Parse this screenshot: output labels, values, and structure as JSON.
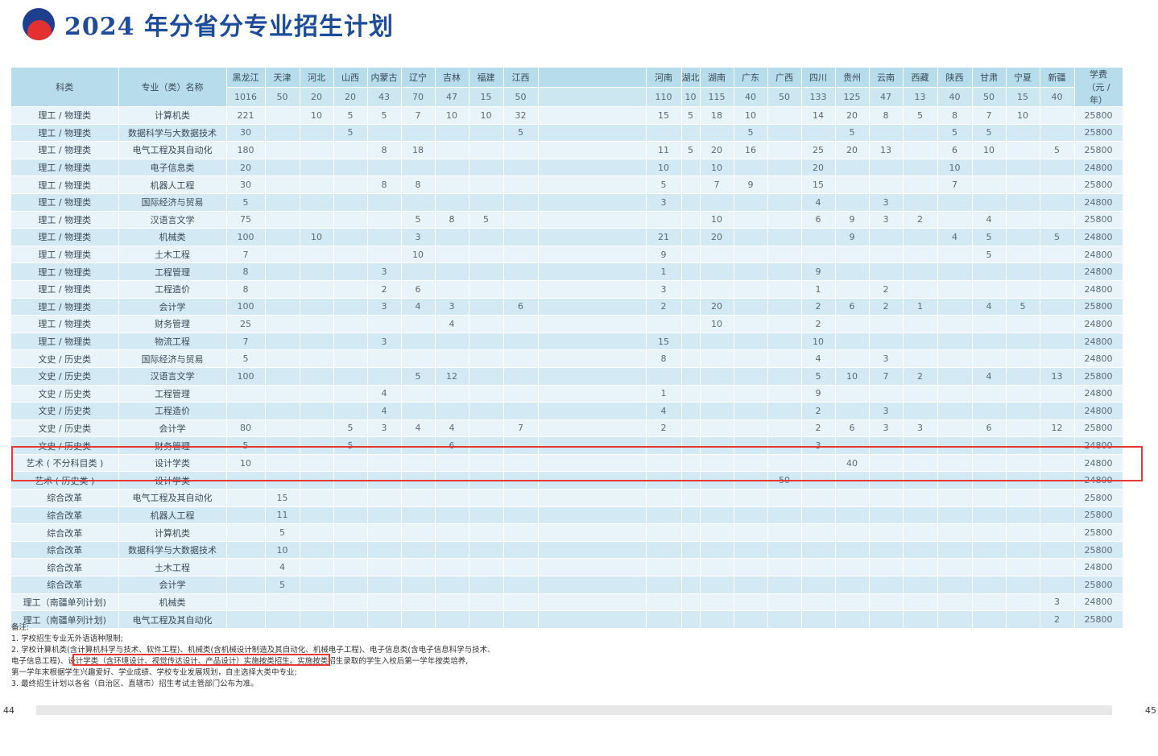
{
  "title": "2024 年分省分专业招生计划",
  "header": {
    "category": "科类",
    "major": "专业（类）名称",
    "tuition": "学费（元 / 年）",
    "provinces": [
      "黑龙江",
      "天津",
      "河北",
      "山西",
      "内蒙古",
      "辽宁",
      "吉林",
      "福建",
      "江西",
      "",
      "河南",
      "湖北",
      "湖南",
      "广东",
      "广西",
      "四川",
      "贵州",
      "云南",
      "西藏",
      "陕西",
      "甘肃",
      "宁夏",
      "新疆"
    ],
    "totals": [
      "1016",
      "50",
      "20",
      "20",
      "43",
      "70",
      "47",
      "15",
      "50",
      "",
      "110",
      "10",
      "115",
      "40",
      "50",
      "133",
      "125",
      "47",
      "13",
      "40",
      "50",
      "15",
      "40"
    ]
  },
  "rows": [
    {
      "category": "理工 / 物理类",
      "major": "计算机类",
      "values": [
        "221",
        "",
        "10",
        "5",
        "5",
        "7",
        "10",
        "10",
        "32",
        "",
        "15",
        "5",
        "18",
        "10",
        "",
        "14",
        "20",
        "8",
        "5",
        "8",
        "7",
        "10",
        ""
      ],
      "fee": "25800"
    },
    {
      "category": "理工 / 物理类",
      "major": "数据科学与大数据技术",
      "values": [
        "30",
        "",
        "",
        "5",
        "",
        "",
        "",
        "",
        "5",
        "",
        "",
        "",
        "",
        "5",
        "",
        "",
        "5",
        "",
        "",
        "5",
        "5",
        "",
        ""
      ],
      "fee": "25800"
    },
    {
      "category": "理工 / 物理类",
      "major": "电气工程及其自动化",
      "values": [
        "180",
        "",
        "",
        "",
        "8",
        "18",
        "",
        "",
        "",
        "",
        "11",
        "5",
        "20",
        "16",
        "",
        "25",
        "20",
        "13",
        "",
        "6",
        "10",
        "",
        "5"
      ],
      "fee": "25800"
    },
    {
      "category": "理工 / 物理类",
      "major": "电子信息类",
      "values": [
        "20",
        "",
        "",
        "",
        "",
        "",
        "",
        "",
        "",
        "",
        "10",
        "",
        "10",
        "",
        "",
        "20",
        "",
        "",
        "",
        "10",
        "",
        "",
        ""
      ],
      "fee": "24800"
    },
    {
      "category": "理工 / 物理类",
      "major": "机器人工程",
      "values": [
        "30",
        "",
        "",
        "",
        "8",
        "8",
        "",
        "",
        "",
        "",
        "5",
        "",
        "7",
        "9",
        "",
        "15",
        "",
        "",
        "",
        "7",
        "",
        "",
        ""
      ],
      "fee": "25800"
    },
    {
      "category": "理工 / 物理类",
      "major": "国际经济与贸易",
      "values": [
        "5",
        "",
        "",
        "",
        "",
        "",
        "",
        "",
        "",
        "",
        "3",
        "",
        "",
        "",
        "",
        "4",
        "",
        "3",
        "",
        "",
        "",
        "",
        ""
      ],
      "fee": "24800"
    },
    {
      "category": "理工 / 物理类",
      "major": "汉语言文学",
      "values": [
        "75",
        "",
        "",
        "",
        "",
        "5",
        "8",
        "5",
        "",
        "",
        "",
        "",
        "10",
        "",
        "",
        "6",
        "9",
        "3",
        "2",
        "",
        "4",
        "",
        ""
      ],
      "fee": "25800"
    },
    {
      "category": "理工 / 物理类",
      "major": "机械类",
      "values": [
        "100",
        "",
        "10",
        "",
        "",
        "3",
        "",
        "",
        "",
        "",
        "21",
        "",
        "20",
        "",
        "",
        "",
        "9",
        "",
        "",
        "4",
        "5",
        "",
        "5"
      ],
      "fee": "24800"
    },
    {
      "category": "理工 / 物理类",
      "major": "土木工程",
      "values": [
        "7",
        "",
        "",
        "",
        "",
        "10",
        "",
        "",
        "",
        "",
        "9",
        "",
        "",
        "",
        "",
        "",
        "",
        "",
        "",
        "",
        "5",
        "",
        ""
      ],
      "fee": "24800"
    },
    {
      "category": "理工 / 物理类",
      "major": "工程管理",
      "values": [
        "8",
        "",
        "",
        "",
        "3",
        "",
        "",
        "",
        "",
        "",
        "1",
        "",
        "",
        "",
        "",
        "9",
        "",
        "",
        "",
        "",
        "",
        "",
        ""
      ],
      "fee": "24800"
    },
    {
      "category": "理工 / 物理类",
      "major": "工程造价",
      "values": [
        "8",
        "",
        "",
        "",
        "2",
        "6",
        "",
        "",
        "",
        "",
        "3",
        "",
        "",
        "",
        "",
        "1",
        "",
        "2",
        "",
        "",
        "",
        "",
        ""
      ],
      "fee": "24800"
    },
    {
      "category": "理工 / 物理类",
      "major": "会计学",
      "values": [
        "100",
        "",
        "",
        "",
        "3",
        "4",
        "3",
        "",
        "6",
        "",
        "2",
        "",
        "20",
        "",
        "",
        "2",
        "6",
        "2",
        "1",
        "",
        "4",
        "5",
        ""
      ],
      "fee": "25800"
    },
    {
      "category": "理工 / 物理类",
      "major": "财务管理",
      "values": [
        "25",
        "",
        "",
        "",
        "",
        "",
        "4",
        "",
        "",
        "",
        "",
        "",
        "10",
        "",
        "",
        "2",
        "",
        "",
        "",
        "",
        "",
        "",
        ""
      ],
      "fee": "24800"
    },
    {
      "category": "理工 / 物理类",
      "major": "物流工程",
      "values": [
        "7",
        "",
        "",
        "",
        "3",
        "",
        "",
        "",
        "",
        "",
        "15",
        "",
        "",
        "",
        "",
        "10",
        "",
        "",
        "",
        "",
        "",
        "",
        ""
      ],
      "fee": "24800"
    },
    {
      "category": "文史 / 历史类",
      "major": "国际经济与贸易",
      "values": [
        "5",
        "",
        "",
        "",
        "",
        "",
        "",
        "",
        "",
        "",
        "8",
        "",
        "",
        "",
        "",
        "4",
        "",
        "3",
        "",
        "",
        "",
        "",
        ""
      ],
      "fee": "24800"
    },
    {
      "category": "文史 / 历史类",
      "major": "汉语言文学",
      "values": [
        "100",
        "",
        "",
        "",
        "",
        "5",
        "12",
        "",
        "",
        "",
        "",
        "",
        "",
        "",
        "",
        "5",
        "10",
        "7",
        "2",
        "",
        "4",
        "",
        "13"
      ],
      "fee": "25800"
    },
    {
      "category": "文史 / 历史类",
      "major": "工程管理",
      "values": [
        "",
        "",
        "",
        "",
        "4",
        "",
        "",
        "",
        "",
        "",
        "1",
        "",
        "",
        "",
        "",
        "9",
        "",
        "",
        "",
        "",
        "",
        "",
        ""
      ],
      "fee": "24800"
    },
    {
      "category": "文史 / 历史类",
      "major": "工程造价",
      "values": [
        "",
        "",
        "",
        "",
        "4",
        "",
        "",
        "",
        "",
        "",
        "4",
        "",
        "",
        "",
        "",
        "2",
        "",
        "3",
        "",
        "",
        "",
        "",
        ""
      ],
      "fee": "24800"
    },
    {
      "category": "文史 / 历史类",
      "major": "会计学",
      "values": [
        "80",
        "",
        "",
        "5",
        "3",
        "4",
        "4",
        "",
        "7",
        "",
        "2",
        "",
        "",
        "",
        "",
        "2",
        "6",
        "3",
        "3",
        "",
        "6",
        "",
        "12"
      ],
      "fee": "25800"
    },
    {
      "category": "文史 / 历史类",
      "major": "财务管理",
      "values": [
        "5",
        "",
        "",
        "5",
        "",
        "",
        "6",
        "",
        "",
        "",
        "",
        "",
        "",
        "",
        "",
        "3",
        "",
        "",
        "",
        "",
        "",
        "",
        ""
      ],
      "fee": "24800"
    },
    {
      "category": "艺术 ( 不分科目类 )",
      "major": "设计学类",
      "values": [
        "10",
        "",
        "",
        "",
        "",
        "",
        "",
        "",
        "",
        "",
        "",
        "",
        "",
        "",
        "",
        "",
        "40",
        "",
        "",
        "",
        "",
        "",
        ""
      ],
      "fee": "24800"
    },
    {
      "category": "艺术 ( 历史类 )",
      "major": "设计学类",
      "values": [
        "",
        "",
        "",
        "",
        "",
        "",
        "",
        "",
        "",
        "",
        "",
        "",
        "",
        "",
        "50",
        "",
        "",
        "",
        "",
        "",
        "",
        "",
        ""
      ],
      "fee": "24800"
    },
    {
      "category": "综合改革",
      "major": "电气工程及其自动化",
      "values": [
        "",
        "15",
        "",
        "",
        "",
        "",
        "",
        "",
        "",
        "",
        "",
        "",
        "",
        "",
        "",
        "",
        "",
        "",
        "",
        "",
        "",
        "",
        ""
      ],
      "fee": "25800"
    },
    {
      "category": "综合改革",
      "major": "机器人工程",
      "values": [
        "",
        "11",
        "",
        "",
        "",
        "",
        "",
        "",
        "",
        "",
        "",
        "",
        "",
        "",
        "",
        "",
        "",
        "",
        "",
        "",
        "",
        "",
        ""
      ],
      "fee": "25800"
    },
    {
      "category": "综合改革",
      "major": "计算机类",
      "values": [
        "",
        "5",
        "",
        "",
        "",
        "",
        "",
        "",
        "",
        "",
        "",
        "",
        "",
        "",
        "",
        "",
        "",
        "",
        "",
        "",
        "",
        "",
        ""
      ],
      "fee": "25800"
    },
    {
      "category": "综合改革",
      "major": "数据科学与大数据技术",
      "values": [
        "",
        "10",
        "",
        "",
        "",
        "",
        "",
        "",
        "",
        "",
        "",
        "",
        "",
        "",
        "",
        "",
        "",
        "",
        "",
        "",
        "",
        "",
        ""
      ],
      "fee": "25800"
    },
    {
      "category": "综合改革",
      "major": "土木工程",
      "values": [
        "",
        "4",
        "",
        "",
        "",
        "",
        "",
        "",
        "",
        "",
        "",
        "",
        "",
        "",
        "",
        "",
        "",
        "",
        "",
        "",
        "",
        "",
        ""
      ],
      "fee": "24800"
    },
    {
      "category": "综合改革",
      "major": "会计学",
      "values": [
        "",
        "5",
        "",
        "",
        "",
        "",
        "",
        "",
        "",
        "",
        "",
        "",
        "",
        "",
        "",
        "",
        "",
        "",
        "",
        "",
        "",
        "",
        ""
      ],
      "fee": "25800"
    },
    {
      "category": "理工（南疆单列计划)",
      "major": "机械类",
      "values": [
        "",
        "",
        "",
        "",
        "",
        "",
        "",
        "",
        "",
        "",
        "",
        "",
        "",
        "",
        "",
        "",
        "",
        "",
        "",
        "",
        "",
        "",
        "3"
      ],
      "fee": "24800"
    },
    {
      "category": "理工（南疆单列计划)",
      "major": "电气工程及其自动化",
      "values": [
        "",
        "",
        "",
        "",
        "",
        "",
        "",
        "",
        "",
        "",
        "",
        "",
        "",
        "",
        "",
        "",
        "",
        "",
        "",
        "",
        "",
        "",
        "2"
      ],
      "fee": "25800"
    }
  ],
  "notes": {
    "heading": "备注:",
    "line1": "1. 学校招生专业无外语语种限制;",
    "line2": "2. 学校计算机类(含计算机科学与技术、软件工程)、机械类(含机械设计制造及其自动化、机械电子工程)、电子信息类(含电子信息科学与技术、",
    "line3a": "电子信息工程)、",
    "line3b": "设计学类（含环境设计、视觉传达设计、产品设计）实施按类招生。",
    "line3c": "实施按类招生录取的学生入校后第一学年按类培养,",
    "line4": "第一学年末根据学生兴趣爱好、学业成绩、学校专业发展规划，自主选择大类中专业;",
    "line5": "3. 最终招生计划以各省（自治区、直辖市）招生考试主管部门公布为准。"
  },
  "page_left": "44",
  "page_right": "45"
}
